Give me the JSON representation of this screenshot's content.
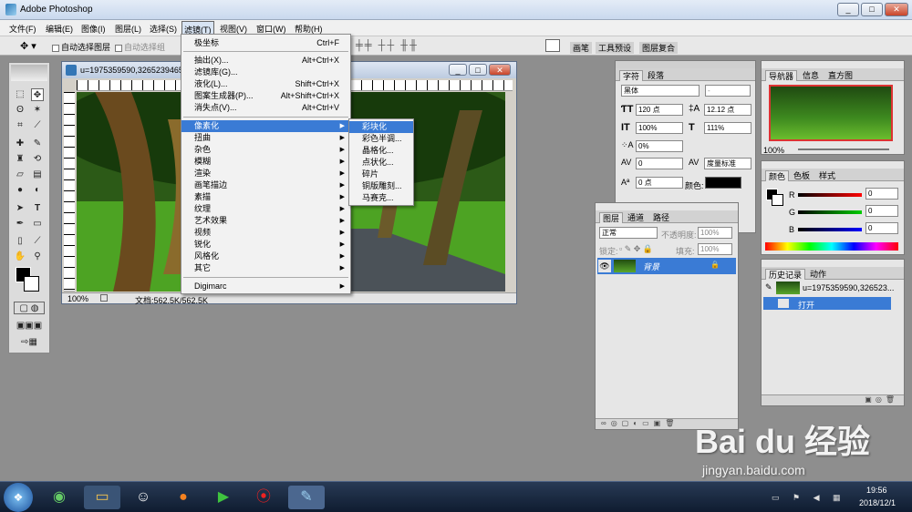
{
  "app": {
    "title": "Adobe Photoshop",
    "win_min": "_",
    "win_max": "□",
    "win_close": "✕"
  },
  "menubar": [
    "文件(F)",
    "编辑(E)",
    "图像(I)",
    "图层(L)",
    "选择(S)",
    "滤镜(T)",
    "视图(V)",
    "窗口(W)",
    "帮助(H)"
  ],
  "options": {
    "auto_select_layer": "自动选择图层",
    "auto_select_group": "自动选择组",
    "palette_tabs": [
      "画笔",
      "工具预设",
      "图层复合"
    ]
  },
  "document": {
    "title": "u=1975359590,3265239465",
    "zoom": "100%",
    "doc_info": "文档:562.5K/562.5K"
  },
  "filter_menu": {
    "items": [
      {
        "label": "极坐标",
        "shortcut": "Ctrl+F"
      },
      {
        "label": "抽出(X)...",
        "shortcut": "Alt+Ctrl+X"
      },
      {
        "label": "滤镜库(G)...",
        "shortcut": ""
      },
      {
        "label": "液化(L)...",
        "shortcut": "Shift+Ctrl+X"
      },
      {
        "label": "图案生成器(P)...",
        "shortcut": "Alt+Shift+Ctrl+X"
      },
      {
        "label": "消失点(V)...",
        "shortcut": "Alt+Ctrl+V"
      },
      {
        "label": "像素化",
        "shortcut": ""
      },
      {
        "label": "扭曲",
        "shortcut": ""
      },
      {
        "label": "杂色",
        "shortcut": ""
      },
      {
        "label": "模糊",
        "shortcut": ""
      },
      {
        "label": "渲染",
        "shortcut": ""
      },
      {
        "label": "画笔描边",
        "shortcut": ""
      },
      {
        "label": "素描",
        "shortcut": ""
      },
      {
        "label": "纹理",
        "shortcut": ""
      },
      {
        "label": "艺术效果",
        "shortcut": ""
      },
      {
        "label": "视频",
        "shortcut": ""
      },
      {
        "label": "锐化",
        "shortcut": ""
      },
      {
        "label": "风格化",
        "shortcut": ""
      },
      {
        "label": "其它",
        "shortcut": ""
      },
      {
        "label": "Digimarc",
        "shortcut": ""
      }
    ]
  },
  "pixelate_submenu": [
    "彩块化",
    "彩色半调...",
    "晶格化...",
    "点状化...",
    "碎片",
    "铜版雕刻...",
    "马赛克..."
  ],
  "char_panel": {
    "tabs": [
      "字符",
      "段落"
    ],
    "font": "黑体",
    "style": "-",
    "size": "120 点",
    "leading": "12.12 点",
    "vscale": "100%",
    "hscale": "111%",
    "tracking": "0%",
    "kerning": "0",
    "kern_mode": "度量标准",
    "baseline": "0 点",
    "color_label": "颜色:"
  },
  "navigator": {
    "tabs": [
      "导航器",
      "信息",
      "直方图"
    ],
    "zoom": "100%"
  },
  "color_panel": {
    "tabs": [
      "颜色",
      "色板",
      "样式"
    ],
    "r_label": "R",
    "g_label": "G",
    "b_label": "B",
    "r": "0",
    "g": "0",
    "b": "0"
  },
  "layers_panel": {
    "tabs": [
      "图层",
      "通道",
      "路径"
    ],
    "blend": "正常",
    "opacity_label": "不透明度:",
    "opacity": "100%",
    "lock_label": "锁定:",
    "fill_label": "填充:",
    "fill": "100%",
    "layer_name": "背景"
  },
  "history_panel": {
    "tabs": [
      "历史记录",
      "动作"
    ],
    "snapshot": "u=1975359590,326523...",
    "step": "打开"
  },
  "taskbar": {
    "time": "19:56",
    "date": "2018/12/1"
  },
  "watermark": {
    "logo": "Bai du 经验",
    "url": "jingyan.baidu.com"
  },
  "colors": {
    "highlight": "#3a7bd5",
    "titlebar": "#c9d9ee"
  }
}
